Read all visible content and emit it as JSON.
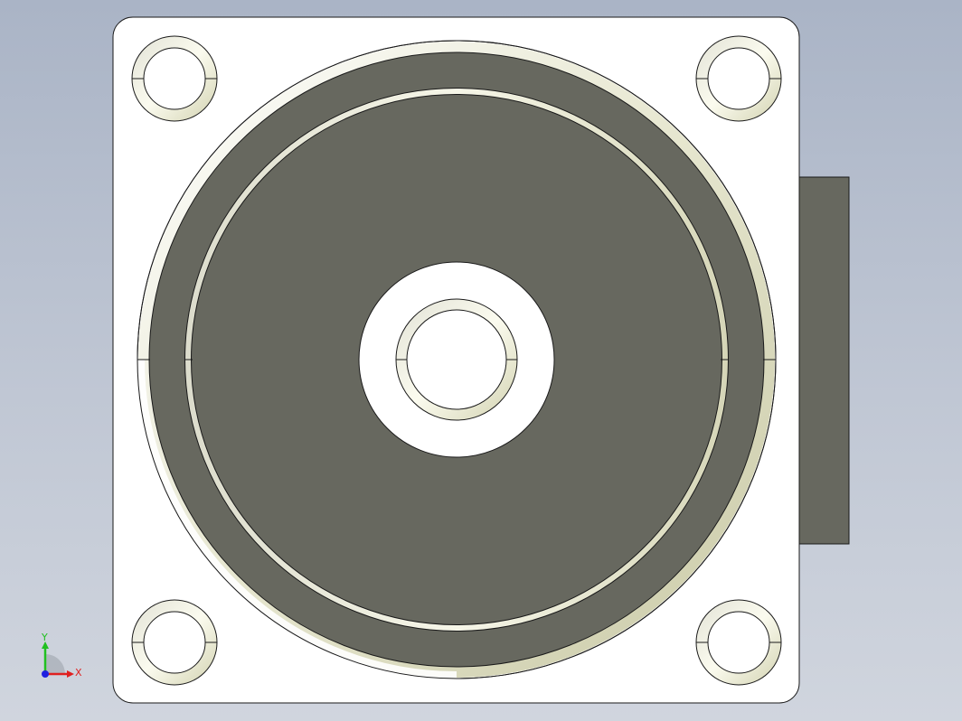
{
  "viewport": {
    "model": "motor-flange-front-view",
    "background_top": "#aab4c6",
    "background_bottom": "#d0d5de"
  },
  "colors": {
    "face": "#ffffff",
    "dark_face": "#67685f",
    "edge": "#1a1a1a",
    "chamfer_light": "#f4f4e4",
    "chamfer_shade": "#c9c9a8",
    "side_box": "#67685f"
  },
  "triad": {
    "x_label": "X",
    "y_label": "Y",
    "x_color": "#e02020",
    "y_color": "#20c020",
    "z_color": "#2020e0"
  }
}
